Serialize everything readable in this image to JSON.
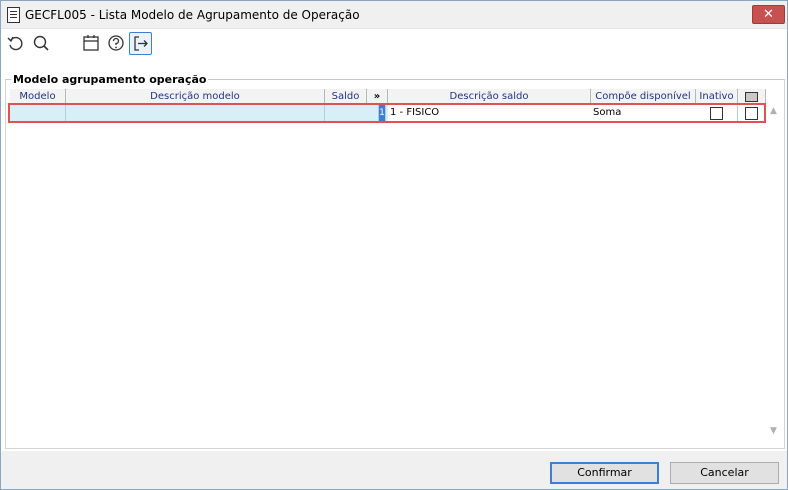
{
  "window": {
    "title": "GECFL005 - Lista Modelo de Agrupamento de Operação",
    "close_label": "✕"
  },
  "toolbar": {
    "icons": [
      "refresh-icon",
      "search-icon",
      "calendar-icon",
      "help-icon",
      "exit-icon"
    ]
  },
  "group": {
    "legend": "Modelo agrupamento operação"
  },
  "grid": {
    "columns": [
      "Modelo",
      "Descrição modelo",
      "Saldo",
      "»",
      "Descrição saldo",
      "Compõe disponível",
      "Inativo"
    ],
    "row": {
      "modelo": "",
      "descricao_modelo": "",
      "saldo": "",
      "saldo_code": "1",
      "descricao_saldo": "1 - FISICO",
      "compoe_disponivel": "Soma"
    }
  },
  "footer": {
    "confirm_label": "Confirmar",
    "cancel_label": "Cancelar"
  }
}
